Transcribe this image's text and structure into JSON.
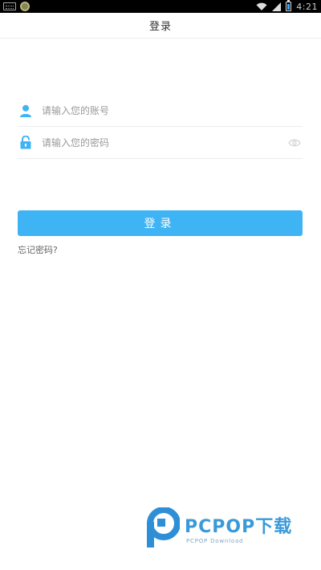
{
  "status_bar": {
    "time": "4:21",
    "icons": [
      "keyboard-icon",
      "app-badge-icon",
      "wifi-icon",
      "signal-icon",
      "battery-icon"
    ],
    "battery_color": "#38a9ff"
  },
  "header": {
    "title": "登录"
  },
  "form": {
    "account": {
      "placeholder": "请输入您的账号",
      "value": "",
      "icon": "user-icon"
    },
    "password": {
      "placeholder": "请输入您的密码",
      "value": "",
      "icon": "lock-icon",
      "toggle_icon": "eye-icon"
    },
    "submit_label": "登录",
    "forgot_label": "忘记密码?"
  },
  "colors": {
    "accent": "#3fb4f5",
    "icon": "#3fb4f5"
  },
  "watermark": {
    "brand": "PCPOP下载",
    "subtitle": "PCPOP Download"
  }
}
